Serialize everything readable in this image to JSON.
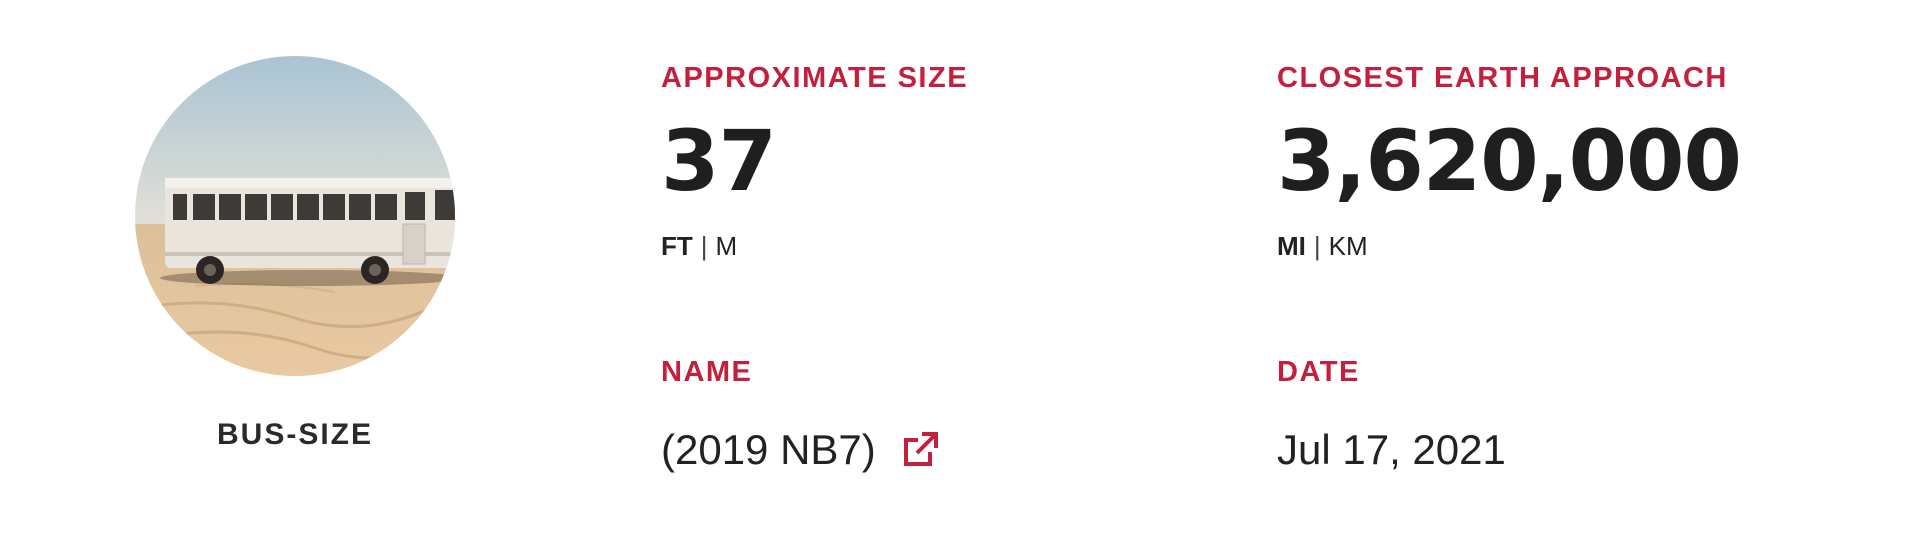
{
  "size_comparison": {
    "image_icon": "bus-photo",
    "label": "BUS-SIZE"
  },
  "approximate_size": {
    "label": "APPROXIMATE SIZE",
    "value": "37",
    "unit_active": "FT",
    "unit_separator": "|",
    "unit_inactive": "M"
  },
  "closest_approach": {
    "label": "CLOSEST EARTH APPROACH",
    "value": "3,620,000",
    "unit_active": "MI",
    "unit_separator": "|",
    "unit_inactive": "KM"
  },
  "name": {
    "label": "NAME",
    "value": "(2019 NB7)",
    "link_icon": "external-link-icon"
  },
  "date": {
    "label": "DATE",
    "value": "Jul 17, 2021"
  },
  "colors": {
    "accent": "#c3203e",
    "text": "#222222",
    "background": "#ffffff"
  }
}
